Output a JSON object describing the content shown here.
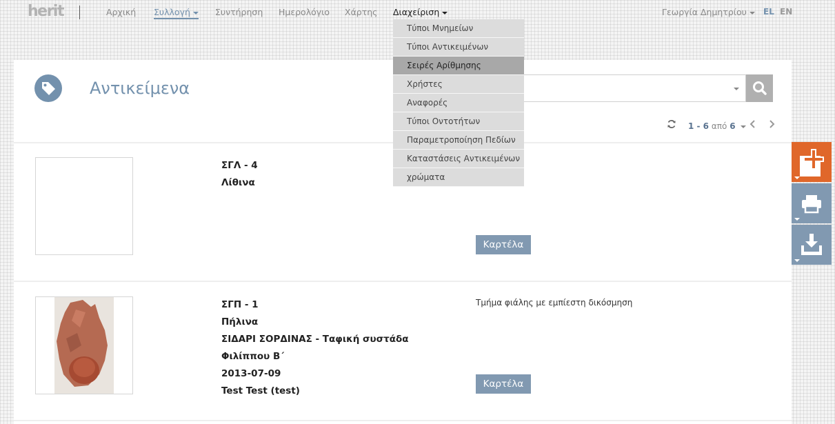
{
  "brand": {
    "logo_text": "herit"
  },
  "nav": {
    "items": [
      {
        "label": "Αρχική"
      },
      {
        "label": "Συλλογή"
      },
      {
        "label": "Συντήρηση"
      },
      {
        "label": "Ημερολόγιο"
      },
      {
        "label": "Χάρτης"
      },
      {
        "label": "Διαχείριση"
      }
    ],
    "user": "Γεωργία Δημητρίου",
    "lang_el": "EL",
    "lang_en": "EN"
  },
  "dropdown": {
    "items": [
      {
        "label": "Τύποι Μνημείων"
      },
      {
        "label": "Τύποι Αντικειμένων"
      },
      {
        "label": "Σειρές Αρίθμησης"
      },
      {
        "label": "Χρήστες"
      },
      {
        "label": "Αναφορές"
      },
      {
        "label": "Τύποι Οντοτήτων"
      },
      {
        "label": "Παραμετροποίηση Πεδίων"
      },
      {
        "label": "Καταστάσεις Αντικειμένων"
      },
      {
        "label": "χρώματα"
      }
    ],
    "hovered": "Σειρές Αρίθμησης"
  },
  "page": {
    "title": "Αντικείμενα"
  },
  "pager": {
    "range": "1 - 6",
    "of": "από",
    "total": "6"
  },
  "records": [
    {
      "code": "ΣΓΛ - 4",
      "material": "Λίθινα",
      "location": "",
      "date": "",
      "author": "",
      "description": "",
      "button": "Καρτέλα"
    },
    {
      "code": "ΣΓΠ - 1",
      "material": "Πήλινα",
      "location": "ΣΙΔΑΡΙ ΣΟΡΔΙΝΑΣ - Ταφική συστάδα Φιλίππου Β΄",
      "date": "2013-07-09",
      "author": "Test Test (test)",
      "description": "Τμήμα φιάλης με εμπίεστη δικόσμηση",
      "button": "Καρτέλα"
    }
  ],
  "icons": {
    "tag": "tag-icon",
    "search": "search-icon",
    "refresh": "refresh-icon",
    "prev": "chevron-left-icon",
    "next": "chevron-right-icon",
    "add": "add-icon",
    "print": "print-icon",
    "download": "download-icon"
  },
  "colors": {
    "accent": "#7391ad",
    "button": "#8199b1",
    "add_button": "#e0672a",
    "dropdown_bg": "#dcdcdc",
    "dropdown_hover": "#a8a8a8"
  }
}
